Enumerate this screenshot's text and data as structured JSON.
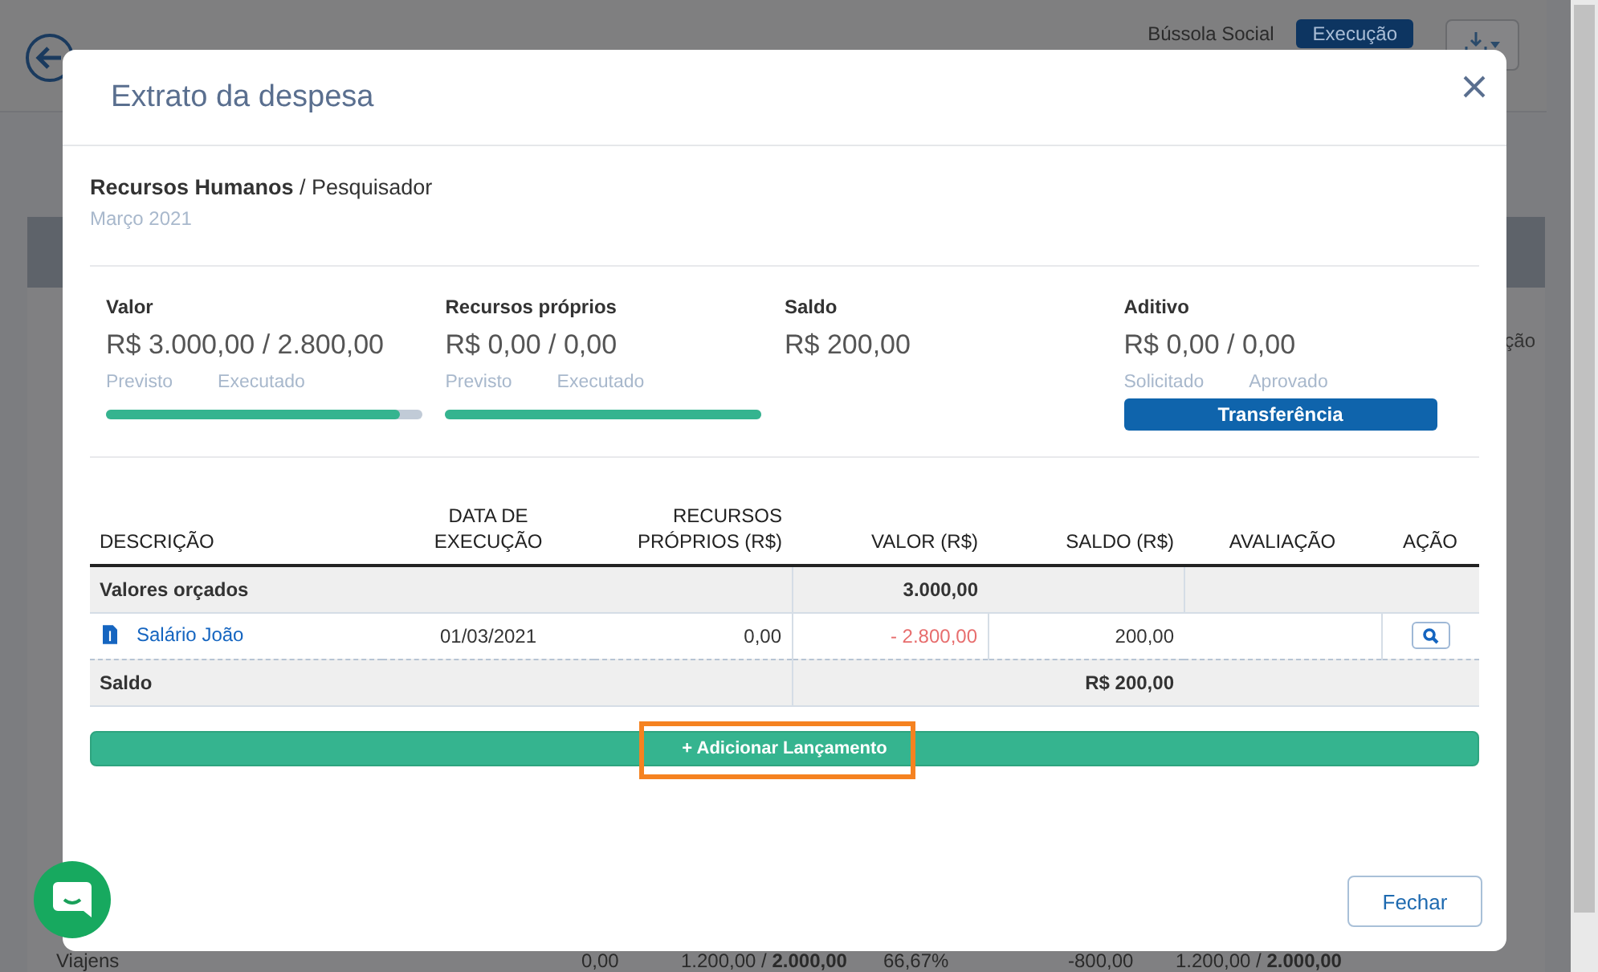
{
  "background": {
    "brand": "Bússola Social",
    "phase_button": "Execução",
    "column_fragment": "ção",
    "footer_row": [
      "Viajens",
      "0,00",
      "1.200,00 / **2.000,00**",
      "66,67%",
      "-800,00",
      "1.200,00 / **2.000,00**"
    ]
  },
  "modal": {
    "title": "Extrato da despesa",
    "breadcrumb": "**Recursos Humanos** / Pesquisador",
    "period": "Março 2021",
    "stats": [
      {
        "kind": "bar",
        "label": "Valor",
        "value": "R$ 3.000,00 / 2.800,00",
        "sublabels": [
          "Previsto",
          "Executado"
        ],
        "level": 0.93
      },
      {
        "kind": "bar",
        "label": "Recursos próprios",
        "value": "R$ 0,00 / 0,00",
        "sublabels": [
          "Previsto",
          "Executado"
        ],
        "level": 1
      },
      {
        "kind": "plain",
        "label": "Saldo",
        "value": "R$ 200,00"
      },
      {
        "kind": "button",
        "label": "Aditivo",
        "value": "R$ 0,00 / 0,00",
        "sublabels": [
          "Solicitado",
          "Aprovado"
        ],
        "button": "Transferência"
      }
    ],
    "table": {
      "columns": [
        "DESCRIÇÃO",
        "DATA DE EXECUÇÃO",
        "RECURSOS PRÓPRIOS (R$)",
        "VALOR (R$)",
        "SALDO (R$)",
        "AVALIAÇÃO",
        "AÇÃO"
      ],
      "rows": [
        {
          "kind": "group",
          "cells": [
            "Valores orçados",
            "",
            "",
            "3.000,00",
            "",
            "",
            ""
          ]
        },
        {
          "kind": "entry",
          "cells": [
            "Salário João",
            "01/03/2021",
            "0,00",
            "- 2.800,00",
            "200,00",
            "",
            ""
          ]
        },
        {
          "kind": "total",
          "cells": [
            "Saldo",
            "",
            "",
            "",
            "R$ 200,00",
            "",
            ""
          ]
        }
      ]
    },
    "add_button": "+ Adicionar Lançamento",
    "highlighted": true,
    "close_button": "Fechar"
  }
}
